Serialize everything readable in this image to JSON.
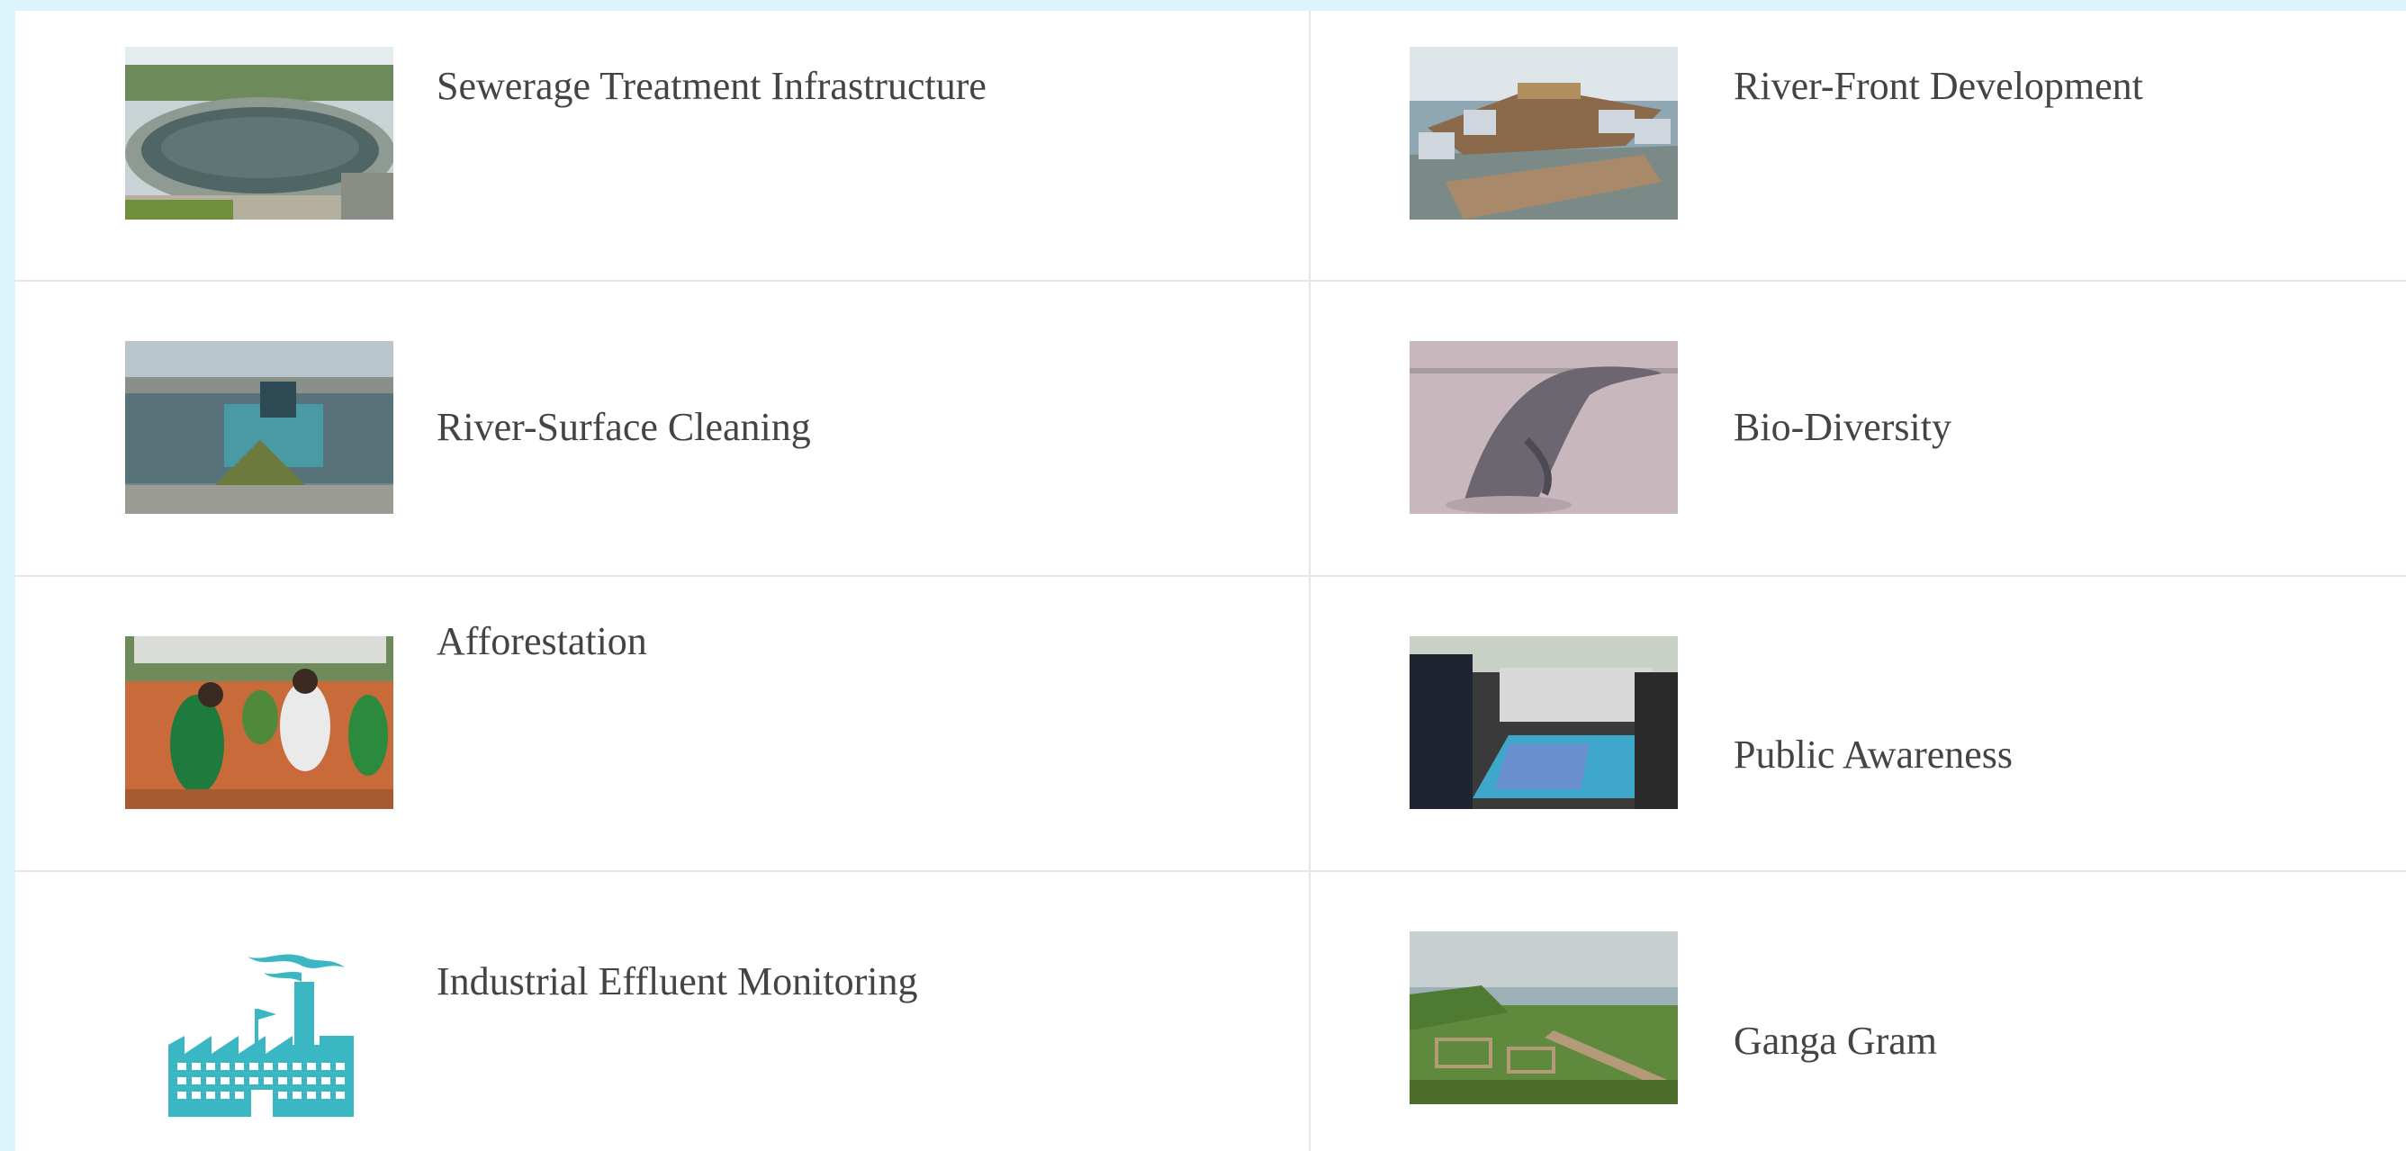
{
  "items": [
    {
      "label": "Sewerage Treatment Infrastructure",
      "icon": "sewerage-treatment-photo"
    },
    {
      "label": "River-Front Development",
      "icon": "river-front-photo"
    },
    {
      "label": "River-Surface Cleaning",
      "icon": "river-surface-cleaning-photo"
    },
    {
      "label": "Bio-Diversity",
      "icon": "dolphin-photo"
    },
    {
      "label": "Afforestation",
      "icon": "afforestation-photo"
    },
    {
      "label": "Public Awareness",
      "icon": "public-awareness-photo"
    },
    {
      "label": "Industrial Effluent Monitoring",
      "icon": "factory-icon"
    },
    {
      "label": "Ganga Gram",
      "icon": "ganga-gram-photo"
    }
  ],
  "colors": {
    "background": "#dcf5fd",
    "panel": "#ffffff",
    "text": "#444444",
    "divider": "#e6e6e6",
    "factory_icon": "#3bb7c3"
  }
}
